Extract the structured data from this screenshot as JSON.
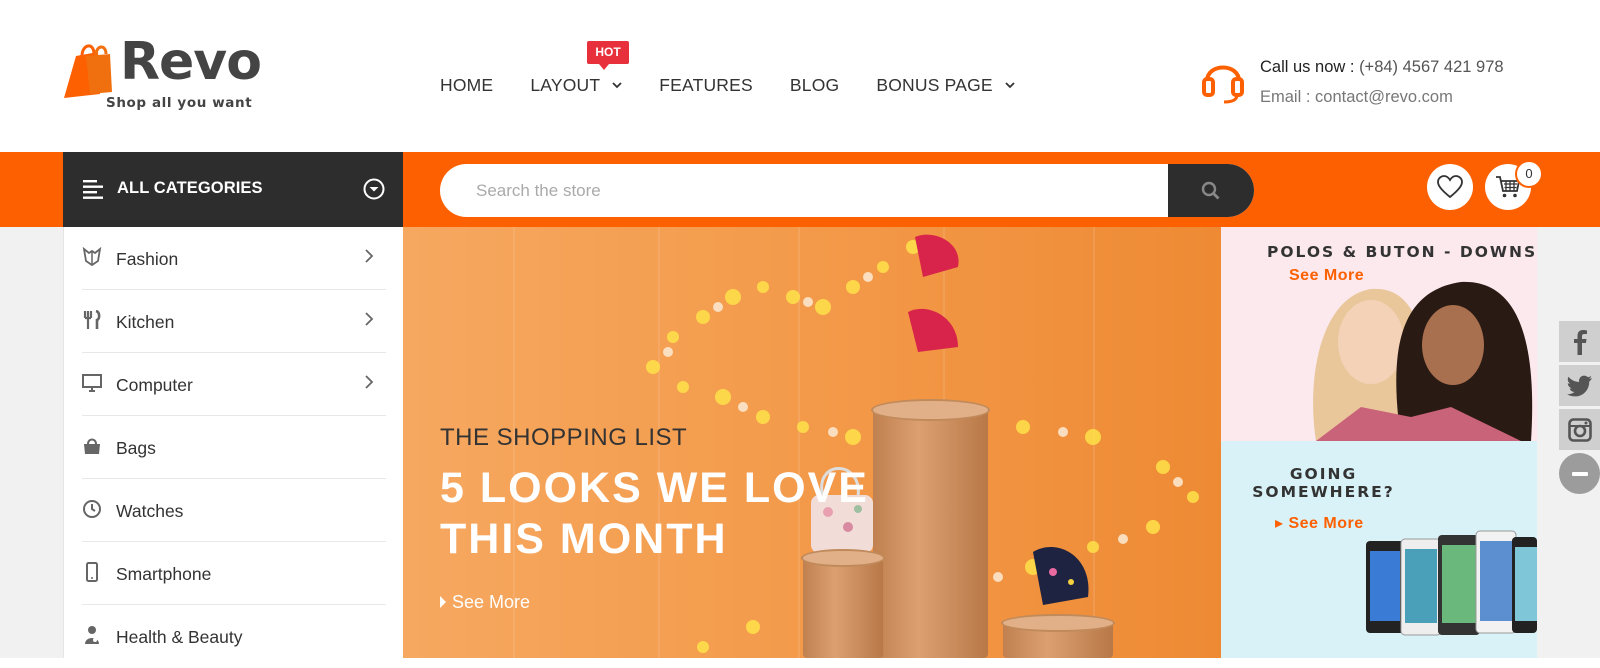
{
  "brand": {
    "name": "Revo",
    "tagline": "Shop all you want",
    "accent_color": "#fd6001",
    "dark_color": "#2d2d2d",
    "hot_color": "#e8303c"
  },
  "nav": {
    "items": [
      {
        "label": "HOME",
        "has_dropdown": false
      },
      {
        "label": "LAYOUT",
        "has_dropdown": true,
        "badge": "HOT"
      },
      {
        "label": "FEATURES",
        "has_dropdown": false
      },
      {
        "label": "BLOG",
        "has_dropdown": false
      },
      {
        "label": "BONUS PAGE",
        "has_dropdown": true
      }
    ]
  },
  "contact": {
    "icon": "headphones-icon",
    "call_label": "Call us now :",
    "phone": "(+84) 4567 421 978",
    "email_label": "Email :",
    "email": "contact@revo.com"
  },
  "toolbar": {
    "all_categories_label": "ALL CATEGORIES",
    "search_placeholder": "Search the store",
    "cart_count": "0"
  },
  "categories": [
    {
      "label": "Fashion",
      "icon": "fashion-icon",
      "has_submenu": true
    },
    {
      "label": "Kitchen",
      "icon": "kitchen-icon",
      "has_submenu": true
    },
    {
      "label": "Computer",
      "icon": "monitor-icon",
      "has_submenu": true
    },
    {
      "label": "Bags",
      "icon": "bag-icon",
      "has_submenu": false
    },
    {
      "label": "Watches",
      "icon": "clock-icon",
      "has_submenu": false
    },
    {
      "label": "Smartphone",
      "icon": "phone-icon",
      "has_submenu": false
    },
    {
      "label": "Health & Beauty",
      "icon": "beauty-icon",
      "has_submenu": false
    }
  ],
  "banner": {
    "subtitle": "THE SHOPPING LIST",
    "title_line1": "5 LOOKS WE LOVE",
    "title_line2": "THIS MONTH",
    "link": "See More"
  },
  "promos": [
    {
      "title": "POLOS & BUTON - DOWNS",
      "link": "See More"
    },
    {
      "title_line1": "GOING",
      "title_line2": "SOMEWHERE?",
      "link": "See More"
    }
  ],
  "social": [
    "facebook-icon",
    "twitter-icon",
    "instagram-icon",
    "minus-icon"
  ]
}
